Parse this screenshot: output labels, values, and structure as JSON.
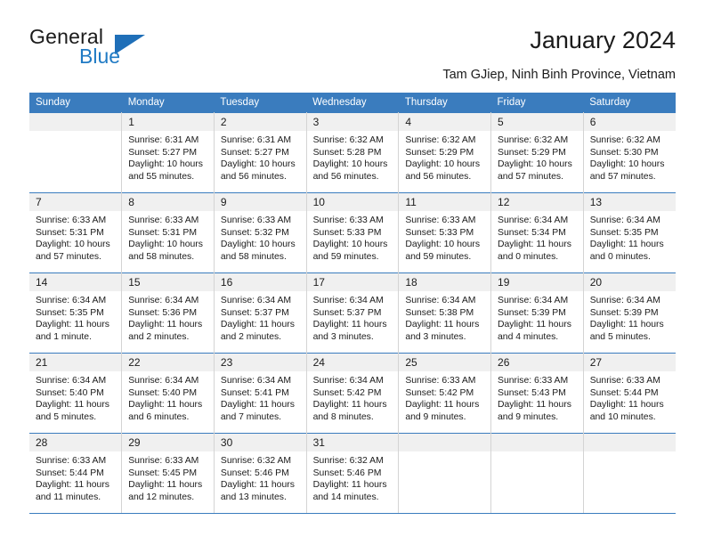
{
  "brand": {
    "name_top": "General",
    "name_bottom": "Blue",
    "triangle_color": "#1f6fb8",
    "blue_text_color": "#1f7ac4"
  },
  "header": {
    "title": "January 2024",
    "subtitle": "Tam GJiep, Ninh Binh Province, Vietnam"
  },
  "theme": {
    "header_row_bg": "#3a7cbe",
    "header_row_text": "#ffffff",
    "daynum_bg": "#f0f0f0",
    "cell_border": "#d4d4d4",
    "week_border": "#3a7cbe"
  },
  "weekday_headers": [
    "Sunday",
    "Monday",
    "Tuesday",
    "Wednesday",
    "Thursday",
    "Friday",
    "Saturday"
  ],
  "weeks": [
    [
      {
        "day": "",
        "sunrise": "",
        "sunset": "",
        "daylight_line1": "",
        "daylight_line2": ""
      },
      {
        "day": "1",
        "sunrise": "Sunrise: 6:31 AM",
        "sunset": "Sunset: 5:27 PM",
        "daylight_line1": "Daylight: 10 hours",
        "daylight_line2": "and 55 minutes."
      },
      {
        "day": "2",
        "sunrise": "Sunrise: 6:31 AM",
        "sunset": "Sunset: 5:27 PM",
        "daylight_line1": "Daylight: 10 hours",
        "daylight_line2": "and 56 minutes."
      },
      {
        "day": "3",
        "sunrise": "Sunrise: 6:32 AM",
        "sunset": "Sunset: 5:28 PM",
        "daylight_line1": "Daylight: 10 hours",
        "daylight_line2": "and 56 minutes."
      },
      {
        "day": "4",
        "sunrise": "Sunrise: 6:32 AM",
        "sunset": "Sunset: 5:29 PM",
        "daylight_line1": "Daylight: 10 hours",
        "daylight_line2": "and 56 minutes."
      },
      {
        "day": "5",
        "sunrise": "Sunrise: 6:32 AM",
        "sunset": "Sunset: 5:29 PM",
        "daylight_line1": "Daylight: 10 hours",
        "daylight_line2": "and 57 minutes."
      },
      {
        "day": "6",
        "sunrise": "Sunrise: 6:32 AM",
        "sunset": "Sunset: 5:30 PM",
        "daylight_line1": "Daylight: 10 hours",
        "daylight_line2": "and 57 minutes."
      }
    ],
    [
      {
        "day": "7",
        "sunrise": "Sunrise: 6:33 AM",
        "sunset": "Sunset: 5:31 PM",
        "daylight_line1": "Daylight: 10 hours",
        "daylight_line2": "and 57 minutes."
      },
      {
        "day": "8",
        "sunrise": "Sunrise: 6:33 AM",
        "sunset": "Sunset: 5:31 PM",
        "daylight_line1": "Daylight: 10 hours",
        "daylight_line2": "and 58 minutes."
      },
      {
        "day": "9",
        "sunrise": "Sunrise: 6:33 AM",
        "sunset": "Sunset: 5:32 PM",
        "daylight_line1": "Daylight: 10 hours",
        "daylight_line2": "and 58 minutes."
      },
      {
        "day": "10",
        "sunrise": "Sunrise: 6:33 AM",
        "sunset": "Sunset: 5:33 PM",
        "daylight_line1": "Daylight: 10 hours",
        "daylight_line2": "and 59 minutes."
      },
      {
        "day": "11",
        "sunrise": "Sunrise: 6:33 AM",
        "sunset": "Sunset: 5:33 PM",
        "daylight_line1": "Daylight: 10 hours",
        "daylight_line2": "and 59 minutes."
      },
      {
        "day": "12",
        "sunrise": "Sunrise: 6:34 AM",
        "sunset": "Sunset: 5:34 PM",
        "daylight_line1": "Daylight: 11 hours",
        "daylight_line2": "and 0 minutes."
      },
      {
        "day": "13",
        "sunrise": "Sunrise: 6:34 AM",
        "sunset": "Sunset: 5:35 PM",
        "daylight_line1": "Daylight: 11 hours",
        "daylight_line2": "and 0 minutes."
      }
    ],
    [
      {
        "day": "14",
        "sunrise": "Sunrise: 6:34 AM",
        "sunset": "Sunset: 5:35 PM",
        "daylight_line1": "Daylight: 11 hours",
        "daylight_line2": "and 1 minute."
      },
      {
        "day": "15",
        "sunrise": "Sunrise: 6:34 AM",
        "sunset": "Sunset: 5:36 PM",
        "daylight_line1": "Daylight: 11 hours",
        "daylight_line2": "and 2 minutes."
      },
      {
        "day": "16",
        "sunrise": "Sunrise: 6:34 AM",
        "sunset": "Sunset: 5:37 PM",
        "daylight_line1": "Daylight: 11 hours",
        "daylight_line2": "and 2 minutes."
      },
      {
        "day": "17",
        "sunrise": "Sunrise: 6:34 AM",
        "sunset": "Sunset: 5:37 PM",
        "daylight_line1": "Daylight: 11 hours",
        "daylight_line2": "and 3 minutes."
      },
      {
        "day": "18",
        "sunrise": "Sunrise: 6:34 AM",
        "sunset": "Sunset: 5:38 PM",
        "daylight_line1": "Daylight: 11 hours",
        "daylight_line2": "and 3 minutes."
      },
      {
        "day": "19",
        "sunrise": "Sunrise: 6:34 AM",
        "sunset": "Sunset: 5:39 PM",
        "daylight_line1": "Daylight: 11 hours",
        "daylight_line2": "and 4 minutes."
      },
      {
        "day": "20",
        "sunrise": "Sunrise: 6:34 AM",
        "sunset": "Sunset: 5:39 PM",
        "daylight_line1": "Daylight: 11 hours",
        "daylight_line2": "and 5 minutes."
      }
    ],
    [
      {
        "day": "21",
        "sunrise": "Sunrise: 6:34 AM",
        "sunset": "Sunset: 5:40 PM",
        "daylight_line1": "Daylight: 11 hours",
        "daylight_line2": "and 5 minutes."
      },
      {
        "day": "22",
        "sunrise": "Sunrise: 6:34 AM",
        "sunset": "Sunset: 5:40 PM",
        "daylight_line1": "Daylight: 11 hours",
        "daylight_line2": "and 6 minutes."
      },
      {
        "day": "23",
        "sunrise": "Sunrise: 6:34 AM",
        "sunset": "Sunset: 5:41 PM",
        "daylight_line1": "Daylight: 11 hours",
        "daylight_line2": "and 7 minutes."
      },
      {
        "day": "24",
        "sunrise": "Sunrise: 6:34 AM",
        "sunset": "Sunset: 5:42 PM",
        "daylight_line1": "Daylight: 11 hours",
        "daylight_line2": "and 8 minutes."
      },
      {
        "day": "25",
        "sunrise": "Sunrise: 6:33 AM",
        "sunset": "Sunset: 5:42 PM",
        "daylight_line1": "Daylight: 11 hours",
        "daylight_line2": "and 9 minutes."
      },
      {
        "day": "26",
        "sunrise": "Sunrise: 6:33 AM",
        "sunset": "Sunset: 5:43 PM",
        "daylight_line1": "Daylight: 11 hours",
        "daylight_line2": "and 9 minutes."
      },
      {
        "day": "27",
        "sunrise": "Sunrise: 6:33 AM",
        "sunset": "Sunset: 5:44 PM",
        "daylight_line1": "Daylight: 11 hours",
        "daylight_line2": "and 10 minutes."
      }
    ],
    [
      {
        "day": "28",
        "sunrise": "Sunrise: 6:33 AM",
        "sunset": "Sunset: 5:44 PM",
        "daylight_line1": "Daylight: 11 hours",
        "daylight_line2": "and 11 minutes."
      },
      {
        "day": "29",
        "sunrise": "Sunrise: 6:33 AM",
        "sunset": "Sunset: 5:45 PM",
        "daylight_line1": "Daylight: 11 hours",
        "daylight_line2": "and 12 minutes."
      },
      {
        "day": "30",
        "sunrise": "Sunrise: 6:32 AM",
        "sunset": "Sunset: 5:46 PM",
        "daylight_line1": "Daylight: 11 hours",
        "daylight_line2": "and 13 minutes."
      },
      {
        "day": "31",
        "sunrise": "Sunrise: 6:32 AM",
        "sunset": "Sunset: 5:46 PM",
        "daylight_line1": "Daylight: 11 hours",
        "daylight_line2": "and 14 minutes."
      },
      {
        "day": "",
        "sunrise": "",
        "sunset": "",
        "daylight_line1": "",
        "daylight_line2": ""
      },
      {
        "day": "",
        "sunrise": "",
        "sunset": "",
        "daylight_line1": "",
        "daylight_line2": ""
      },
      {
        "day": "",
        "sunrise": "",
        "sunset": "",
        "daylight_line1": "",
        "daylight_line2": ""
      }
    ]
  ]
}
